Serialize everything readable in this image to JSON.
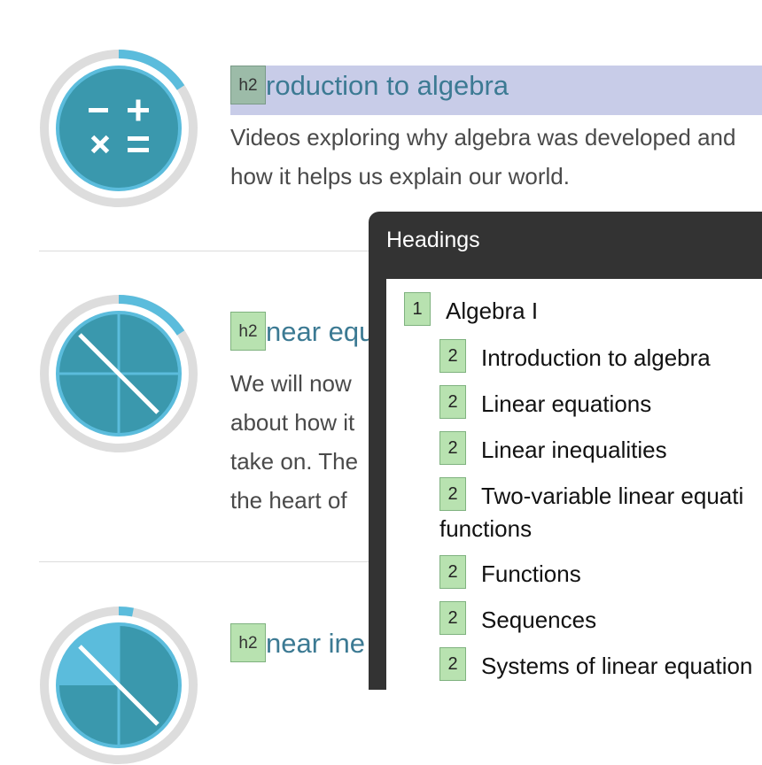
{
  "badge_label": "h2",
  "topics": [
    {
      "heading": "roduction to algebra",
      "description": "Videos exploring why algebra was developed and how it helps us explain our world.",
      "icon": "plus-minus-times-equals-icon"
    },
    {
      "heading": "near equ",
      "description": "We will now about how it take on. The the heart of",
      "icon": "quartered-slash-icon"
    },
    {
      "heading": "near ine",
      "description": "",
      "icon": "quartered-slash-icon"
    }
  ],
  "panel": {
    "title": "Headings",
    "items": [
      {
        "level": "1",
        "text": "Algebra I"
      },
      {
        "level": "2",
        "text": "Introduction to algebra"
      },
      {
        "level": "2",
        "text": "Linear equations"
      },
      {
        "level": "2",
        "text": "Linear inequalities"
      },
      {
        "level": "2",
        "text": "Two-variable linear equati",
        "continuation": "functions"
      },
      {
        "level": "2",
        "text": "Functions"
      },
      {
        "level": "2",
        "text": "Sequences"
      },
      {
        "level": "2",
        "text": "Systems of linear equation"
      }
    ]
  },
  "colors": {
    "accent": "#3c7a93",
    "ring_track": "#dddddd",
    "ring_progress": "#5bbcdc",
    "icon_fill": "#3a98ad",
    "focus_highlight": "#c8cce8",
    "badge_green": "#b8e2b0",
    "panel_bg": "#333333"
  }
}
